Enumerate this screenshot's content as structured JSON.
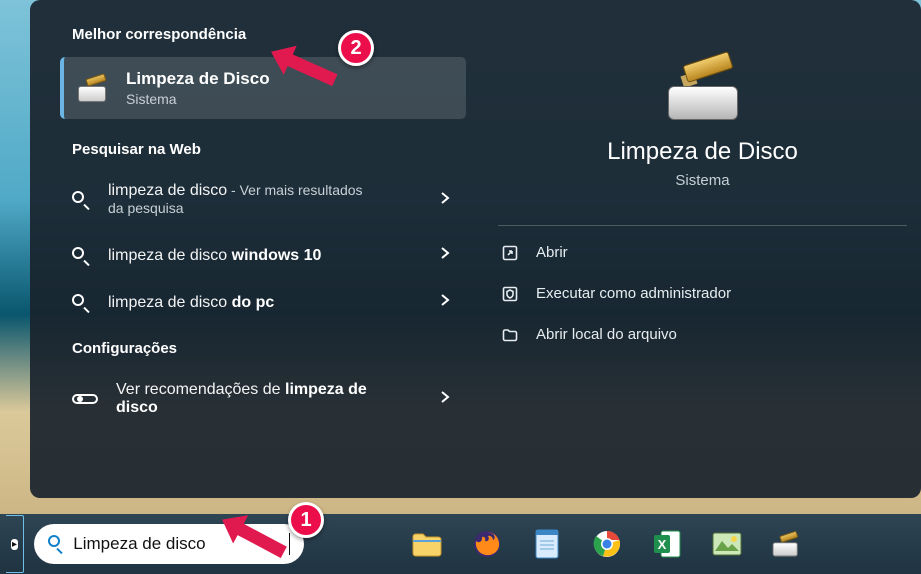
{
  "left": {
    "best_match_heading": "Melhor correspondência",
    "best_match": {
      "title": "Limpeza de Disco",
      "subtitle": "Sistema"
    },
    "web_heading": "Pesquisar na Web",
    "web_results": [
      {
        "prefix": "limpeza de disco",
        "suffix": " - Ver mais resultados da pesquisa"
      },
      {
        "prefix": "limpeza de disco ",
        "bold": "windows 10"
      },
      {
        "prefix": "limpeza de disco ",
        "bold": "do pc"
      }
    ],
    "settings_heading": "Configurações",
    "settings_item": {
      "prefix": "Ver recomendações de ",
      "bold": "limpeza de disco"
    }
  },
  "right": {
    "title": "Limpeza de Disco",
    "subtitle": "Sistema",
    "actions": {
      "open": "Abrir",
      "run_admin": "Executar como administrador",
      "open_location": "Abrir local do arquivo"
    }
  },
  "taskbar": {
    "search_value": "Limpeza de disco"
  },
  "annotations": {
    "step1": "1",
    "step2": "2"
  }
}
